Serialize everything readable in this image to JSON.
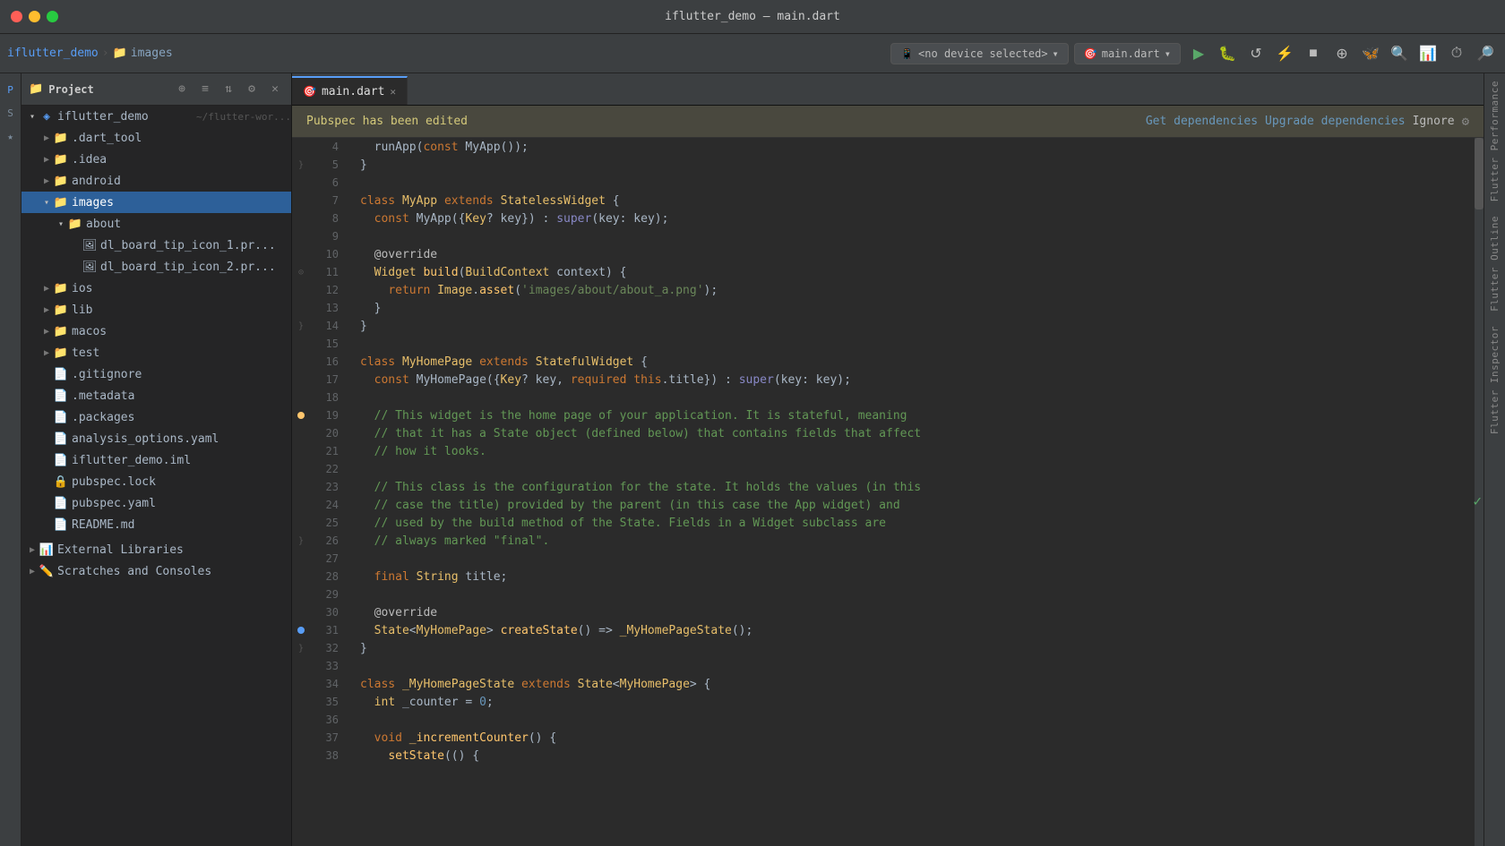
{
  "window": {
    "title": "iflutter_demo – main.dart"
  },
  "toolbar": {
    "breadcrumb_project": "iflutter_demo",
    "breadcrumb_folder": "images",
    "device_label": "<no device selected>",
    "run_config_label": "main.dart"
  },
  "panel": {
    "title": "Project"
  },
  "pubspec_bar": {
    "message": "Pubspec has been edited",
    "get_dependencies": "Get dependencies",
    "upgrade_dependencies": "Upgrade dependencies",
    "ignore": "Ignore"
  },
  "tabs": [
    {
      "label": "main.dart",
      "active": true
    }
  ],
  "tree": {
    "root": "iflutter_demo",
    "root_path": "~/flutter-wor...",
    "items": [
      {
        "label": ".dart_tool",
        "type": "folder",
        "indent": 1,
        "expanded": false
      },
      {
        "label": ".idea",
        "type": "folder",
        "indent": 1,
        "expanded": false
      },
      {
        "label": "android",
        "type": "folder",
        "indent": 1,
        "expanded": false
      },
      {
        "label": "images",
        "type": "folder",
        "indent": 1,
        "expanded": true,
        "selected": true
      },
      {
        "label": "about",
        "type": "folder",
        "indent": 2,
        "expanded": true
      },
      {
        "label": "dl_board_tip_icon_1.pr...",
        "type": "file",
        "indent": 3
      },
      {
        "label": "dl_board_tip_icon_2.pr...",
        "type": "file",
        "indent": 3
      },
      {
        "label": "ios",
        "type": "folder",
        "indent": 1,
        "expanded": false
      },
      {
        "label": "lib",
        "type": "folder",
        "indent": 1,
        "expanded": false
      },
      {
        "label": "macos",
        "type": "folder",
        "indent": 1,
        "expanded": false
      },
      {
        "label": "test",
        "type": "folder",
        "indent": 1,
        "expanded": false
      },
      {
        "label": ".gitignore",
        "type": "gitignore",
        "indent": 1
      },
      {
        "label": ".metadata",
        "type": "meta",
        "indent": 1
      },
      {
        "label": ".packages",
        "type": "packages",
        "indent": 1
      },
      {
        "label": "analysis_options.yaml",
        "type": "yaml",
        "indent": 1
      },
      {
        "label": "iflutter_demo.iml",
        "type": "iml",
        "indent": 1
      },
      {
        "label": "pubspec.lock",
        "type": "lock",
        "indent": 1
      },
      {
        "label": "pubspec.yaml",
        "type": "yaml",
        "indent": 1
      },
      {
        "label": "README.md",
        "type": "md",
        "indent": 1
      }
    ],
    "external_libraries": "External Libraries",
    "scratches": "Scratches and Consoles"
  },
  "code": {
    "lines": [
      {
        "num": 4,
        "text": "  runApp(const MyApp());",
        "tokens": [
          {
            "t": "    runApp(",
            "c": "var"
          },
          {
            "t": "const",
            "c": "kw"
          },
          {
            "t": " MyApp());",
            "c": "var"
          }
        ]
      },
      {
        "num": 5,
        "text": "}",
        "tokens": [
          {
            "t": "}",
            "c": "var"
          }
        ]
      },
      {
        "num": 6,
        "text": "",
        "tokens": []
      },
      {
        "num": 7,
        "text": "class MyApp extends StatelessWidget {",
        "tokens": [
          {
            "t": "class ",
            "c": "kw"
          },
          {
            "t": "MyApp ",
            "c": "cls"
          },
          {
            "t": "extends ",
            "c": "kw"
          },
          {
            "t": "StatelessWidget",
            "c": "type"
          },
          {
            "t": " {",
            "c": "var"
          }
        ]
      },
      {
        "num": 8,
        "text": "  const MyApp({Key? key}) : super(key: key);",
        "tokens": [
          {
            "t": "  ",
            "c": "var"
          },
          {
            "t": "const",
            "c": "kw"
          },
          {
            "t": " MyApp({",
            "c": "var"
          },
          {
            "t": "Key",
            "c": "type"
          },
          {
            "t": "? key}) : ",
            "c": "var"
          },
          {
            "t": "super",
            "c": "builtin"
          },
          {
            "t": "(key: key);",
            "c": "var"
          }
        ]
      },
      {
        "num": 9,
        "text": "",
        "tokens": []
      },
      {
        "num": 10,
        "text": "  @override",
        "tokens": [
          {
            "t": "  @override",
            "c": "ann"
          }
        ]
      },
      {
        "num": 11,
        "text": "  Widget build(BuildContext context) {",
        "tokens": [
          {
            "t": "  ",
            "c": "var"
          },
          {
            "t": "Widget ",
            "c": "type"
          },
          {
            "t": "build",
            "c": "fn"
          },
          {
            "t": "(",
            "c": "var"
          },
          {
            "t": "BuildContext",
            "c": "type"
          },
          {
            "t": " context) {",
            "c": "var"
          }
        ]
      },
      {
        "num": 12,
        "text": "    return Image.asset('images/about/about_a.png');",
        "tokens": [
          {
            "t": "    ",
            "c": "var"
          },
          {
            "t": "return ",
            "c": "kw"
          },
          {
            "t": "Image",
            "c": "cls"
          },
          {
            "t": ".",
            "c": "var"
          },
          {
            "t": "asset",
            "c": "fn"
          },
          {
            "t": "(",
            "c": "var"
          },
          {
            "t": "'images/about/about_a.png'",
            "c": "str"
          },
          {
            "t": ");",
            "c": "var"
          }
        ]
      },
      {
        "num": 13,
        "text": "  }",
        "tokens": [
          {
            "t": "  }",
            "c": "var"
          }
        ]
      },
      {
        "num": 14,
        "text": "}",
        "tokens": [
          {
            "t": "}",
            "c": "var"
          }
        ]
      },
      {
        "num": 15,
        "text": "",
        "tokens": []
      },
      {
        "num": 16,
        "text": "class MyHomePage extends StatefulWidget {",
        "tokens": [
          {
            "t": "class ",
            "c": "kw"
          },
          {
            "t": "MyHomePage ",
            "c": "cls"
          },
          {
            "t": "extends ",
            "c": "kw"
          },
          {
            "t": "StatefulWidget",
            "c": "type"
          },
          {
            "t": " {",
            "c": "var"
          }
        ]
      },
      {
        "num": 17,
        "text": "  const MyHomePage({Key? key, required this.title}) : super(key: key);",
        "tokens": [
          {
            "t": "  ",
            "c": "var"
          },
          {
            "t": "const",
            "c": "kw"
          },
          {
            "t": " MyHomePage({",
            "c": "var"
          },
          {
            "t": "Key",
            "c": "type"
          },
          {
            "t": "? key, ",
            "c": "var"
          },
          {
            "t": "required ",
            "c": "kw"
          },
          {
            "t": "this",
            "c": "kw"
          },
          {
            "t": ".title}) : ",
            "c": "var"
          },
          {
            "t": "super",
            "c": "builtin"
          },
          {
            "t": "(key: key);",
            "c": "var"
          }
        ]
      },
      {
        "num": 18,
        "text": "",
        "tokens": []
      },
      {
        "num": 19,
        "text": "  // This widget is the home page of your application. It is stateful, meaning",
        "tokens": [
          {
            "t": "  // This widget is the home page of your application. It is stateful, meaning",
            "c": "cmt"
          }
        ]
      },
      {
        "num": 20,
        "text": "  // that it has a State object (defined below) that contains fields that affect",
        "tokens": [
          {
            "t": "  // that it has a State object (defined below) that contains fields that affect",
            "c": "cmt"
          }
        ]
      },
      {
        "num": 21,
        "text": "  // how it looks.",
        "tokens": [
          {
            "t": "  // how it looks.",
            "c": "cmt"
          }
        ]
      },
      {
        "num": 22,
        "text": "",
        "tokens": []
      },
      {
        "num": 23,
        "text": "  // This class is the configuration for the state. It holds the values (in this",
        "tokens": [
          {
            "t": "  // This class is the configuration for the state. It holds the values (in this",
            "c": "cmt"
          }
        ]
      },
      {
        "num": 24,
        "text": "  // case the title) provided by the parent (in this case the App widget) and",
        "tokens": [
          {
            "t": "  // case the title) provided by the parent (in this case the App widget) and",
            "c": "cmt"
          }
        ]
      },
      {
        "num": 25,
        "text": "  // used by the build method of the State. Fields in a Widget subclass are",
        "tokens": [
          {
            "t": "  // used by the build method of the State. Fields in a Widget subclass are",
            "c": "cmt"
          }
        ]
      },
      {
        "num": 26,
        "text": "  // always marked \"final\".",
        "tokens": [
          {
            "t": "  // always marked \"final\".",
            "c": "cmt"
          }
        ]
      },
      {
        "num": 27,
        "text": "",
        "tokens": []
      },
      {
        "num": 28,
        "text": "  final String title;",
        "tokens": [
          {
            "t": "  ",
            "c": "var"
          },
          {
            "t": "final ",
            "c": "kw"
          },
          {
            "t": "String ",
            "c": "type"
          },
          {
            "t": "title;",
            "c": "var"
          }
        ]
      },
      {
        "num": 29,
        "text": "",
        "tokens": []
      },
      {
        "num": 30,
        "text": "  @override",
        "tokens": [
          {
            "t": "  @override",
            "c": "ann"
          }
        ]
      },
      {
        "num": 31,
        "text": "  State<MyHomePage> createState() => _MyHomePageState();",
        "tokens": [
          {
            "t": "  ",
            "c": "var"
          },
          {
            "t": "State",
            "c": "type"
          },
          {
            "t": "<",
            "c": "var"
          },
          {
            "t": "MyHomePage",
            "c": "cls"
          },
          {
            "t": "&gt; ",
            "c": "var"
          },
          {
            "t": "createState",
            "c": "fn"
          },
          {
            "t": "() => ",
            "c": "var"
          },
          {
            "t": "_MyHomePageState",
            "c": "cls"
          },
          {
            "t": "();",
            "c": "var"
          }
        ]
      },
      {
        "num": 32,
        "text": "}",
        "tokens": [
          {
            "t": "}",
            "c": "var"
          }
        ]
      },
      {
        "num": 33,
        "text": "",
        "tokens": []
      },
      {
        "num": 34,
        "text": "class _MyHomePageState extends State<MyHomePage> {",
        "tokens": [
          {
            "t": "class ",
            "c": "kw"
          },
          {
            "t": "_MyHomePageState ",
            "c": "cls"
          },
          {
            "t": "extends ",
            "c": "kw"
          },
          {
            "t": "State",
            "c": "type"
          },
          {
            "t": "<",
            "c": "var"
          },
          {
            "t": "MyHomePage",
            "c": "cls"
          },
          {
            "t": "&gt; {",
            "c": "var"
          }
        ]
      },
      {
        "num": 35,
        "text": "  int _counter = 0;",
        "tokens": [
          {
            "t": "  ",
            "c": "var"
          },
          {
            "t": "int ",
            "c": "type"
          },
          {
            "t": "_counter = ",
            "c": "var"
          },
          {
            "t": "0",
            "c": "num"
          },
          {
            "t": ";",
            "c": "var"
          }
        ]
      },
      {
        "num": 36,
        "text": "",
        "tokens": []
      },
      {
        "num": 37,
        "text": "  void _incrementCounter() {",
        "tokens": [
          {
            "t": "  ",
            "c": "var"
          },
          {
            "t": "void ",
            "c": "kw"
          },
          {
            "t": "_incrementCounter",
            "c": "fn"
          },
          {
            "t": "() {",
            "c": "var"
          }
        ]
      },
      {
        "num": 38,
        "text": "    setState(() {",
        "tokens": [
          {
            "t": "    ",
            "c": "var"
          },
          {
            "t": "setState",
            "c": "fn"
          },
          {
            "t": "(() {",
            "c": "var"
          }
        ]
      }
    ]
  },
  "right_tabs": [
    "Flutter Performance",
    "Flutter Outline",
    "Flutter Inspector"
  ],
  "colors": {
    "selected_bg": "#2d6099",
    "pubspec_bg": "#49483e",
    "pubspec_text": "#d4c97a",
    "link_color": "#6897bb"
  }
}
